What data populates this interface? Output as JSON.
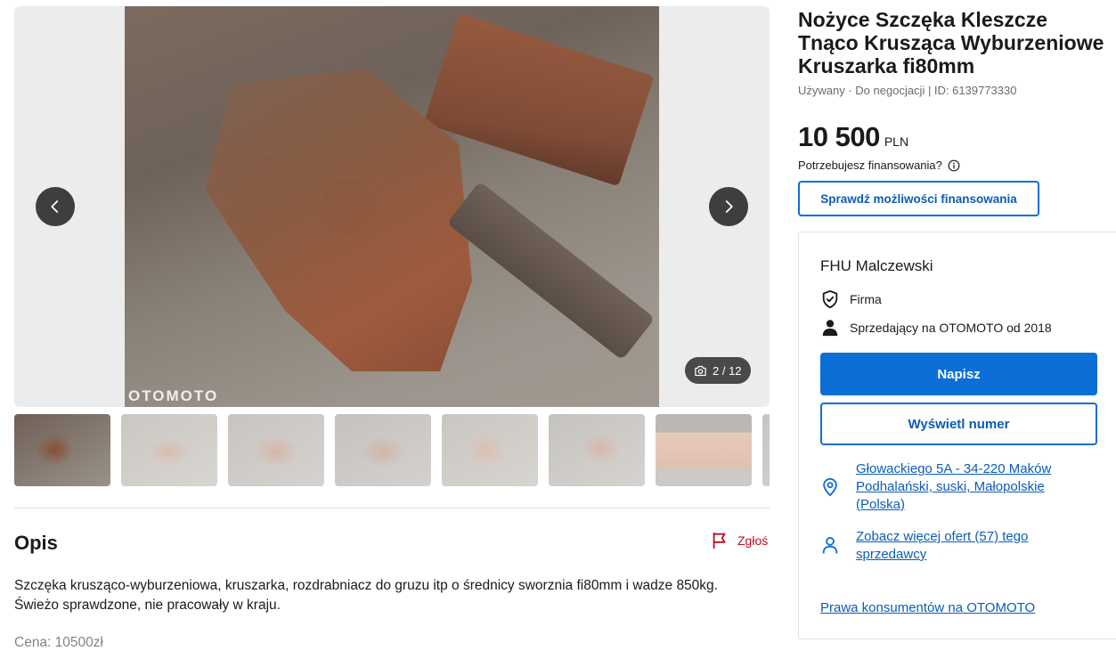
{
  "listing": {
    "title": "Nożyce Szczęka Kleszcze Tnąco Krusząca Wyburzeniowe Kruszarka fi80mm",
    "meta": "Używany · Do negocjacji | ID: 6139773330",
    "price_value": "10 500",
    "price_currency": "PLN",
    "financing_question": "Potrzebujesz finansowania?",
    "financing_button": "Sprawdź możliwości finansowania"
  },
  "gallery": {
    "watermark": "OTOMOTO",
    "counter": "2 / 12",
    "thumbnails": [
      "thumb-1",
      "thumb-2",
      "thumb-3",
      "thumb-4",
      "thumb-5",
      "thumb-6",
      "thumb-7",
      "thumb-8"
    ]
  },
  "description": {
    "heading": "Opis",
    "report_label": "Zgłoś",
    "text_line1": "Szczęka kruszącо-wyburzeniowa, kruszarka, rozdrabniacz do gruzu itp o średnicy sworznia fi80mm i wadze 850kg.",
    "text_line2": "Świeżo sprawdzone, nie pracowały w kraju.",
    "faded_line": "Cena: 10500zł"
  },
  "seller": {
    "name": "FHU Malczewski",
    "type": "Firma",
    "since": "Sprzedający na OTOMOTO od 2018",
    "write_button": "Napisz",
    "phone_button": "Wyświetl numer",
    "location": "Głowackiego 5A - 34-220 Maków Podhalański, suski, Małopolskie (Polska)",
    "more_offers": "Zobacz więcej ofert (57) tego sprzedawcy",
    "consumer_rights": "Prawa konsumentów na OTOMOTO"
  },
  "colors": {
    "accent": "#0b6fd6",
    "link": "#0b5cb8",
    "report": "#c00f1e"
  }
}
